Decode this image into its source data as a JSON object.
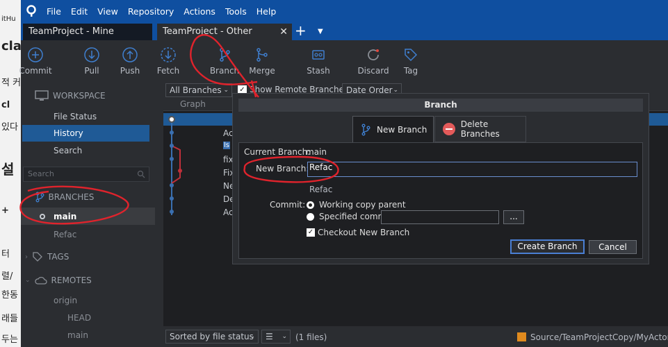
{
  "background_doc": {
    "lines": [
      "itHu",
      "cla",
      "적 커",
      "cl",
      "있다",
      "설",
      "+",
      "터",
      "렬/",
      "한동",
      "래들",
      "두는"
    ]
  },
  "menu": {
    "items": [
      "File",
      "Edit",
      "View",
      "Repository",
      "Actions",
      "Tools",
      "Help"
    ]
  },
  "tabs": {
    "mine": "TeamProject - Mine",
    "other": "TeamProject - Other",
    "close": "✕",
    "add": "+"
  },
  "toolbar": {
    "commit": "Commit",
    "pull": "Pull",
    "push": "Push",
    "fetch": "Fetch",
    "branch": "Branch",
    "merge": "Merge",
    "stash": "Stash",
    "discard": "Discard",
    "tag": "Tag"
  },
  "sidebar": {
    "workspace": "WORKSPACE",
    "file_status": "File Status",
    "history": "History",
    "search": "Search",
    "search_placeholder": "Search",
    "branches": "BRANCHES",
    "branch_main": "main",
    "branch_refac": "Refac",
    "tags": "TAGS",
    "remotes": "REMOTES",
    "origin": "origin",
    "head": "HEAD",
    "remote_main": "main"
  },
  "content": {
    "all_branches": "All Branches",
    "show_remote": "Show Remote Branches",
    "date_order": "Date Order",
    "graph": "Graph",
    "rows": [
      "Ac",
      "Ac",
      "fix",
      "Fix",
      "Ne",
      "De",
      "Ac"
    ]
  },
  "statusbar": {
    "sort": "Sorted by file status",
    "files": "(1 files)",
    "path": "Source/TeamProjectCopy/MyActor.cp"
  },
  "dialog": {
    "title": "Branch",
    "tab_new": "New Branch",
    "tab_delete": "Delete Branches",
    "current_branch_label": "Current Branch:",
    "current_branch_value": "main",
    "new_branch_label": "New Branch:",
    "new_branch_value": "Refac",
    "preview_name": "Refac",
    "commit_label": "Commit:",
    "working_copy_parent": "Working copy parent",
    "specified_commit": "Specified commit:",
    "dots": "...",
    "checkout_label": "Checkout New Branch",
    "create_button": "Create Branch",
    "cancel_button": "Cancel"
  }
}
